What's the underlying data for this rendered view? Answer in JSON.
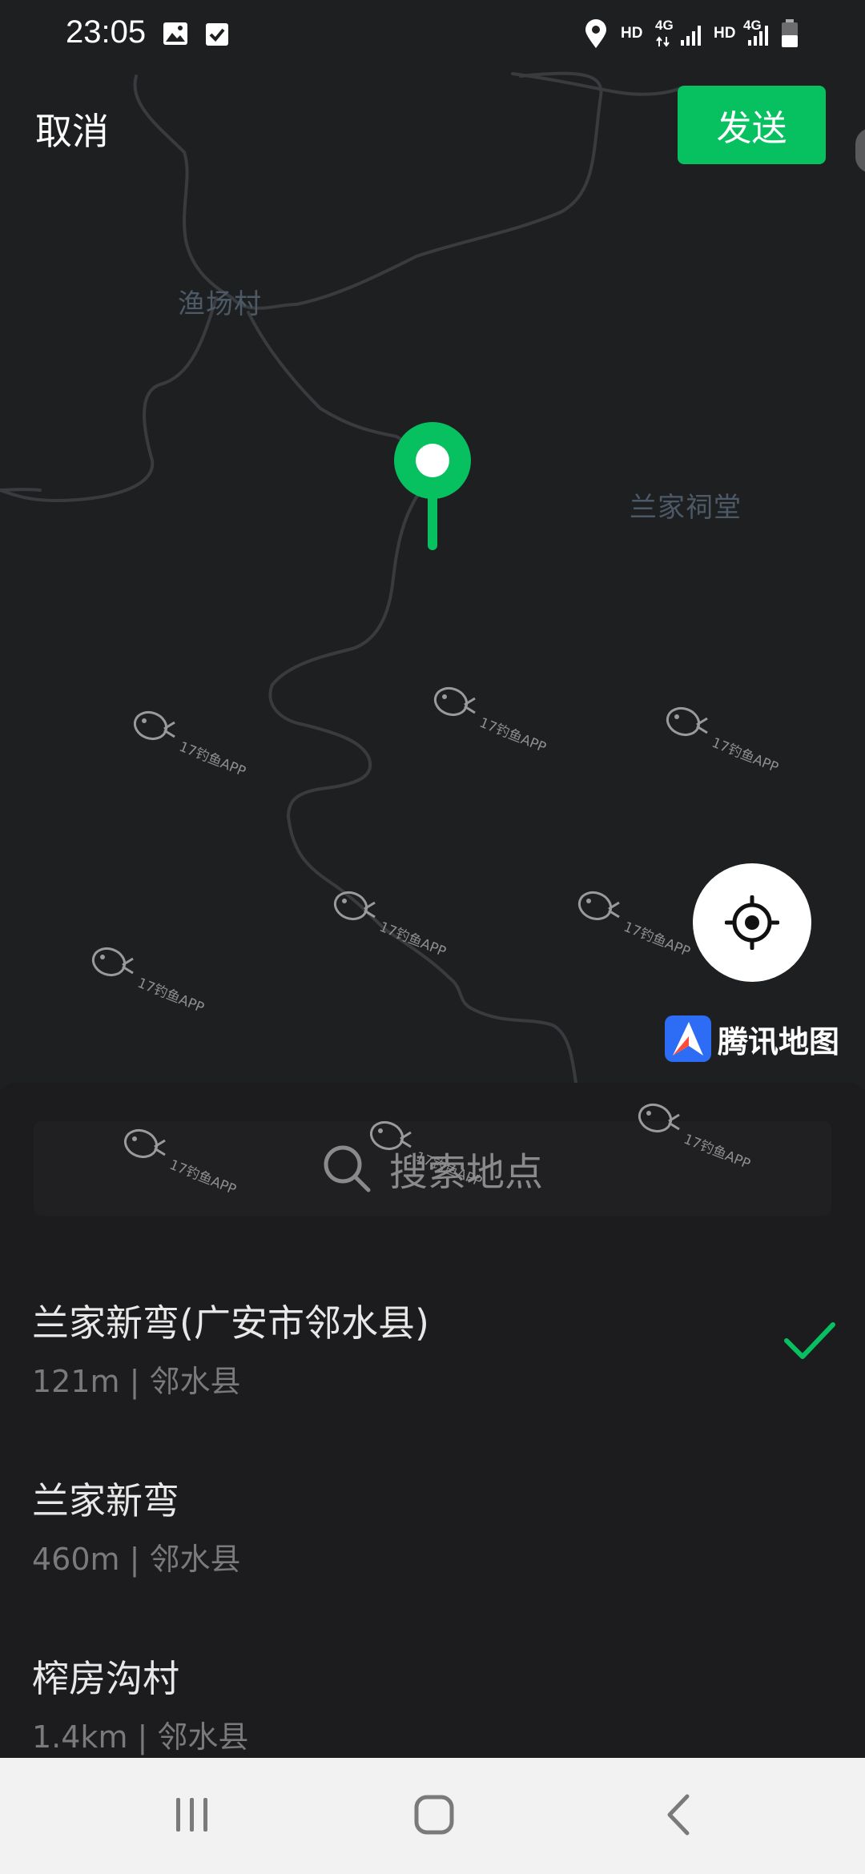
{
  "status_bar": {
    "time": "23:05",
    "icons": [
      "image-icon",
      "checkbox-icon",
      "location-icon",
      "signal-icon",
      "battery-icon"
    ],
    "hd_label_1": "HD",
    "net_label_1": "4G",
    "hd_label_2": "HD",
    "net_label_2": "4G"
  },
  "top_bar": {
    "cancel_label": "取消",
    "send_label": "发送"
  },
  "map": {
    "labels": {
      "village_1": "渔场村",
      "village_2": "兰家祠堂"
    },
    "watermark_text": "17钓鱼APP",
    "provider": "腾讯地图",
    "locate_icon": "crosshair-icon",
    "pin_icon": "map-pin-icon"
  },
  "search": {
    "placeholder": "搜索地点",
    "icon": "search-icon"
  },
  "results": [
    {
      "title": "兰家新弯(广安市邻水县)",
      "subtitle": "121m | 邻水县",
      "selected": true
    },
    {
      "title": "兰家新弯",
      "subtitle": "460m | 邻水县",
      "selected": false
    },
    {
      "title": "榨房沟村",
      "subtitle": "1.4km | 邻水县",
      "selected": false
    }
  ],
  "nav_bar": {
    "recents_icon": "recents-icon",
    "home_icon": "home-icon",
    "back_icon": "back-icon"
  },
  "colors": {
    "accent": "#07c160",
    "map_background": "#1e1f21",
    "sheet_background": "#1c1c1e",
    "nav_background": "#f2f2f2"
  }
}
